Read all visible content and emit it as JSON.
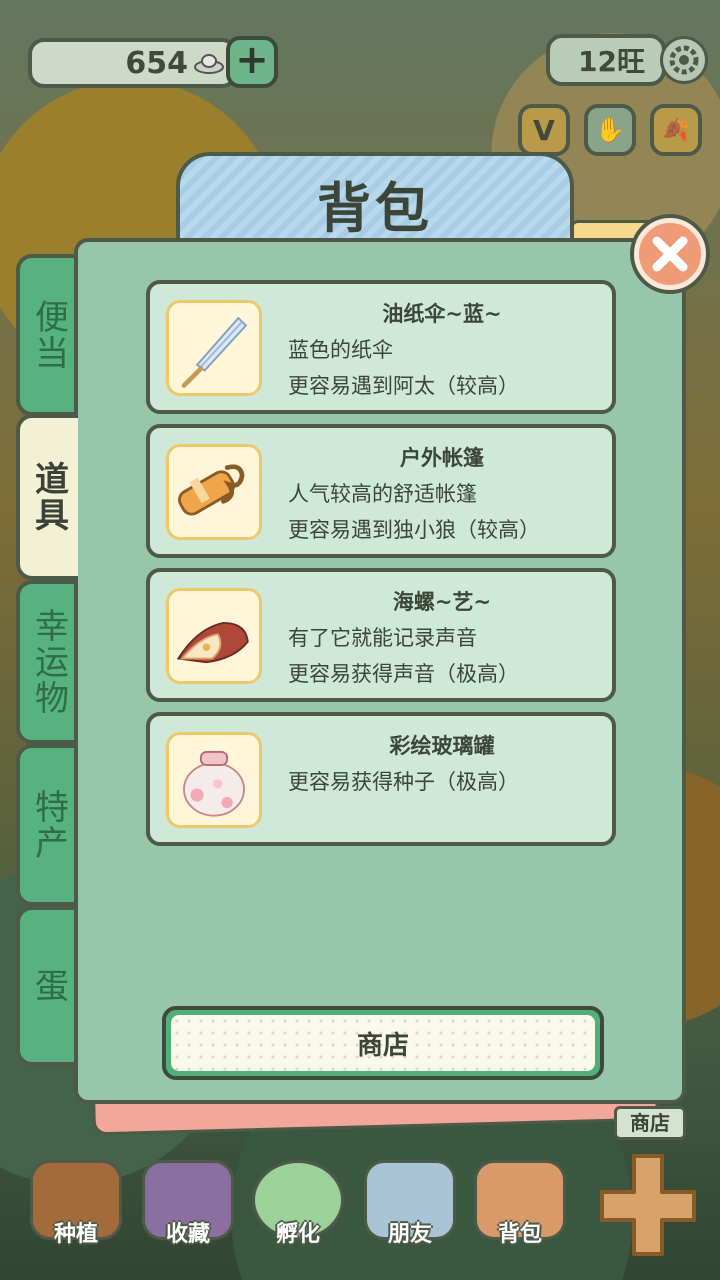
{
  "hud": {
    "coins": "654",
    "add_label": "+",
    "wang": "12旺",
    "quick_buttons": [
      "V",
      "✋",
      "🍂"
    ]
  },
  "panel": {
    "title": "背包",
    "tabs": [
      "便当",
      "道具",
      "幸运物",
      "特产",
      "蛋"
    ],
    "active_tab": "道具",
    "items": [
      {
        "name": "油纸伞~蓝~",
        "lines": [
          "蓝色的纸伞",
          "更容易遇到阿太（较高）"
        ],
        "icon": "paper-umbrella-icon"
      },
      {
        "name": "户外帐篷",
        "lines": [
          "人气较高的舒适帐篷",
          "更容易遇到独小狼（较高）"
        ],
        "icon": "tent-roll-icon"
      },
      {
        "name": "海螺~艺~",
        "lines": [
          "有了它就能记录声音",
          "更容易获得声音（极高）"
        ],
        "icon": "conch-shell-icon"
      },
      {
        "name": "彩绘玻璃罐",
        "lines": [
          "更容易获得种子（极高）"
        ],
        "icon": "painted-jar-icon"
      }
    ],
    "shop_button": "商店"
  },
  "bottom": {
    "shop_badge": "商店",
    "nav": [
      "种植",
      "收藏",
      "孵化",
      "朋友",
      "背包"
    ]
  },
  "colors": {
    "panel": "#96c7ac",
    "tab": "#56b380",
    "active_tab": "#f3f1d3",
    "item_card": "#cee8d9",
    "outline": "#4d5a47",
    "close": "#ef9b78"
  }
}
